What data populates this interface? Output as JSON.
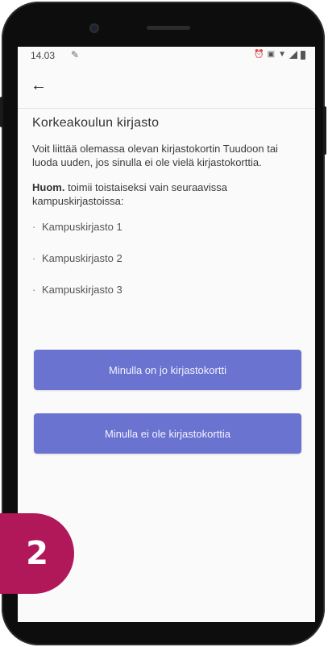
{
  "status_bar": {
    "time": "14.03",
    "notification_icon": "notification-icon"
  },
  "app_bar": {
    "back_icon": "arrow-left-icon",
    "back_glyph": "←"
  },
  "main": {
    "title": "Korkeakoulun kirjasto",
    "intro": "Voit liittää olemassa olevan kirjastokortin Tuudoon tai luoda uuden, jos sinulla ei ole vielä kirjastokorttia.",
    "note_bold": "Huom.",
    "note_rest": " toimii toistaiseksi vain seuraavissa kampuskirjastoissa:",
    "libraries": [
      "Kampuskirjasto 1",
      "Kampuskirjasto 2",
      "Kampuskirjasto 3"
    ]
  },
  "buttons": {
    "has_card": "Minulla on jo kirjastokortti",
    "no_card": "Minulla ei ole kirjastokorttia"
  },
  "badge": {
    "step": "2"
  },
  "colors": {
    "button": "#6a73cf",
    "badge": "#b0185a",
    "screen_bg": "#fafafa",
    "phone": "#0d0d0d"
  }
}
